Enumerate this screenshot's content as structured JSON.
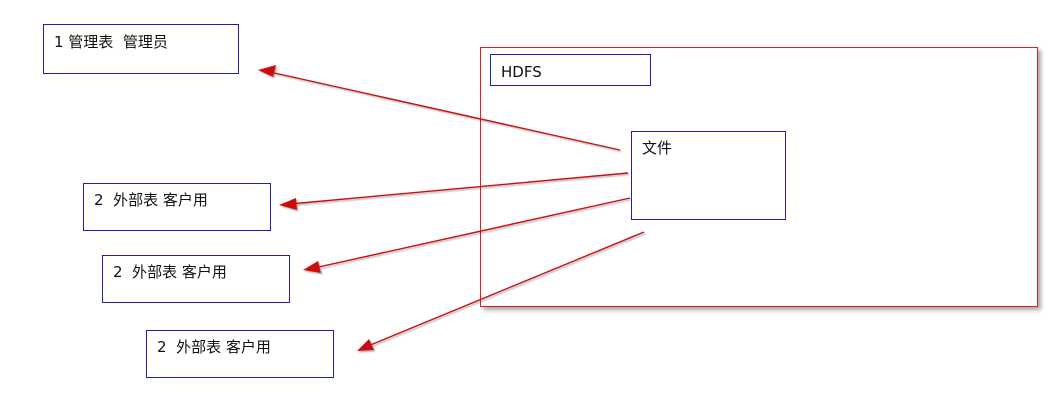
{
  "boxes": {
    "admin_table": "1 管理表  管理员",
    "external_table_1": "2  外部表 客户用",
    "external_table_2": "2  外部表 客户用",
    "external_table_3": "2  外部表 客户用",
    "hdfs": "HDFS",
    "file": "文件"
  },
  "colors": {
    "box_border": "#1f1fb0",
    "container_border": "#e02020",
    "arrow": "#cc1111"
  }
}
